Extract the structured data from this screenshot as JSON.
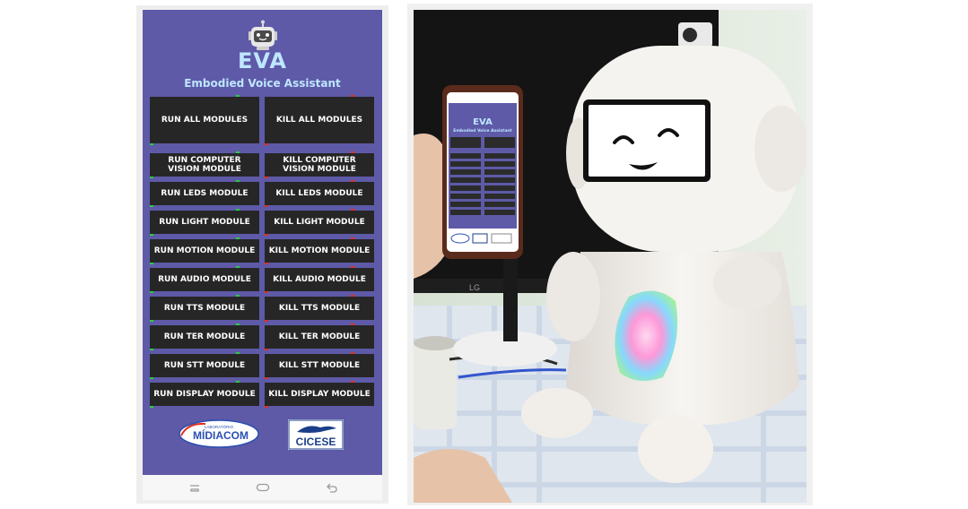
{
  "app": {
    "title": "EVA",
    "subtitle": "Embodied Voice Assistant",
    "logo_icon": "robot-head-icon"
  },
  "buttons": [
    {
      "run": "RUN ALL MODULES",
      "kill": "KILL ALL MODULES"
    },
    {
      "run": "RUN COMPUTER VISION MODULE",
      "kill": "KILL COMPUTER VISION MODULE"
    },
    {
      "run": "RUN LEDS MODULE",
      "kill": "KILL LEDS MODULE"
    },
    {
      "run": "RUN LIGHT MODULE",
      "kill": "KILL LIGHT MODULE"
    },
    {
      "run": "RUN MOTION MODULE",
      "kill": "KILL MOTION MODULE"
    },
    {
      "run": "RUN AUDIO MODULE",
      "kill": "KILL AUDIO MODULE"
    },
    {
      "run": "RUN TTS MODULE",
      "kill": "KILL TTS MODULE"
    },
    {
      "run": "RUN TER MODULE",
      "kill": "KILL TER MODULE"
    },
    {
      "run": "RUN STT MODULE",
      "kill": "KILL STT MODULE"
    },
    {
      "run": "RUN DISPLAY MODULE",
      "kill": "KILL DISPLAY MODULE"
    }
  ],
  "footer_logos": {
    "midiacom_small": "LABORATÓRIO",
    "midiacom": "MÍDIACOM",
    "cicese": "CICESE"
  },
  "nav_bar": {
    "icons": [
      "recents-icon",
      "home-icon",
      "back-icon"
    ]
  },
  "photo": {
    "monitor_brand": "LG",
    "phone_title": "EVA",
    "phone_subtitle": "Embodied Voice Assistant"
  },
  "colors": {
    "app_background": "#5e5aa8",
    "button_background": "#262626",
    "title_color": "#bfe6ff",
    "run_indicator": "#2ecc40",
    "kill_indicator": "#e0301e"
  }
}
